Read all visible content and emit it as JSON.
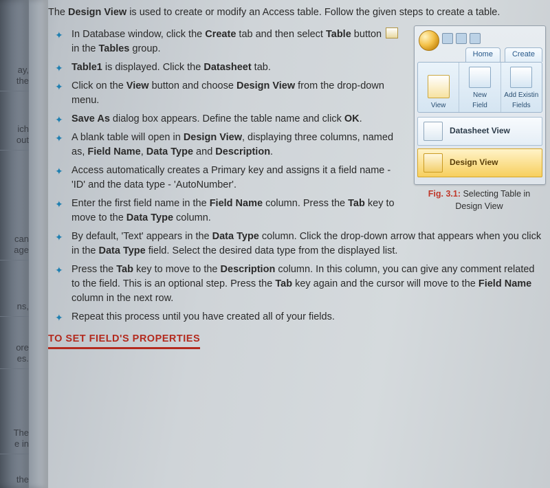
{
  "intro_html": "The <b>Design View</b> is used to create or modify an Access table. Follow the given steps to create a table.",
  "bullets": [
    "In Database window, click the <b>Create</b> tab and then select <b>Table</b> button <span class=\"tblico\"></span> in the <b>Tables</b> group.",
    "<b>Table1</b> is displayed. Click the <b>Datasheet</b> tab.",
    "Click on the <b>View</b> button and choose <b>Design View</b> from the drop-down menu.",
    "<b>Save As</b> dialog box appears. Define the table name and click <b>OK</b>.",
    "A blank table will open in <b>Design View</b>, displaying three columns, named as, <b>Field Name</b>, <b>Data Type</b> and <b>Description</b>.",
    "Access automatically creates a Primary key and assigns it a field name - 'ID' and the data type - 'AutoNumber'.",
    "Enter the first field name in the <b>Field Name</b> column. Press the <b>Tab</b> key to move to the <b>Data Type</b> column.",
    "By default, 'Text' appears in the <b>Data Type</b> column. Click the drop-down arrow that appears when you click in the <b>Data Type</b> field. Select the desired data type from the displayed list.",
    "Press the <b>Tab</b> key to move to the <b>Description</b> column. In this column, you can give any comment related to the field. This is an optional step. Press the <b>Tab</b> key again and the cursor will move to the <b>Field Name</b> column in the next row.",
    "Repeat this process until you have created all of your fields."
  ],
  "set_header": "TO SET FIELD'S PROPERTIES",
  "figure": {
    "tabs": {
      "home": "Home",
      "create": "Create"
    },
    "groups": {
      "view": "View",
      "newfield_l1": "New",
      "newfield_l2": "Field",
      "addexisting_l1": "Add Existin",
      "addexisting_l2": "Fields"
    },
    "menu": {
      "datasheet": "Datasheet View",
      "design": "Design View"
    },
    "caption_label": "Fig. 3.1:",
    "caption_text": "Selecting Table in Design View"
  },
  "prevpage": {
    "f1": "ay,",
    "f2": "the",
    "f3": "ich",
    "f4": "out",
    "f5": "can",
    "f6": "age",
    "f7": "ns,",
    "f8": "ore",
    "f9": "es.",
    "f10": "The",
    "f11": "e in",
    "f12": "the"
  }
}
